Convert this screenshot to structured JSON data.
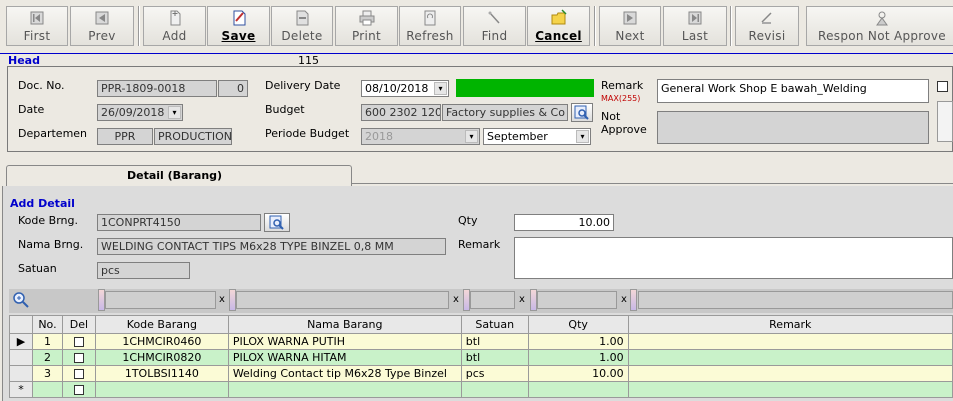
{
  "toolbar": {
    "buttons": [
      {
        "label": "First",
        "icon": "first-icon"
      },
      {
        "label": "Prev",
        "icon": "prev-icon"
      },
      {
        "label": "Add",
        "icon": "add-icon"
      },
      {
        "label": "Save",
        "icon": "save-icon"
      },
      {
        "label": "Delete",
        "icon": "delete-icon"
      },
      {
        "label": "Print",
        "icon": "print-icon"
      },
      {
        "label": "Refresh",
        "icon": "refresh-icon"
      },
      {
        "label": "Find",
        "icon": "find-icon"
      },
      {
        "label": "Cancel",
        "icon": "cancel-icon"
      },
      {
        "label": "Next",
        "icon": "next-icon"
      },
      {
        "label": "Last",
        "icon": "last-icon"
      },
      {
        "label": "Revisi",
        "icon": "revisi-icon"
      },
      {
        "label": "Respon Not Approve",
        "icon": "respon-icon"
      }
    ]
  },
  "head": {
    "title": "Head",
    "counter": "115",
    "doc_no_label": "Doc. No.",
    "doc_no": "PPR-1809-0018",
    "doc_rev": "0",
    "date_label": "Date",
    "date": "26/09/2018",
    "departemen_label": "Departemen",
    "dept_code": "PPR",
    "dept_name": "PRODUCTION",
    "delivery_label": "Delivery Date",
    "delivery_date": "08/10/2018",
    "budget_label": "Budget",
    "budget_code": "600 2302 120",
    "budget_name": "Factory supplies & Co",
    "periode_label": "Periode Budget",
    "periode_year": "2018",
    "periode_month": "September",
    "remark_label": "Remark",
    "remark_max": "MAX(255)",
    "remark": "General Work Shop E bawah_Welding",
    "not_approve_label": "Not\nApprove",
    "not_approve": "",
    "status_color": "#00b400"
  },
  "tab": {
    "label": "Detail (Barang)"
  },
  "detail": {
    "title": "Add Detail",
    "kode_label": "Kode Brng.",
    "kode": "1CONPRT4150",
    "nama_label": "Nama Brng.",
    "nama": "WELDING CONTACT TIPS M6x28 TYPE BINZEL 0,8 MM",
    "satuan_label": "Satuan",
    "satuan": "pcs",
    "qty_label": "Qty",
    "qty": "10.00",
    "remark_label": "Remark",
    "remark": ""
  },
  "grid": {
    "filter_x": "x",
    "columns": [
      "No.",
      "Del",
      "Kode Barang",
      "Nama Barang",
      "Satuan",
      "Qty",
      "Remark"
    ],
    "rows": [
      {
        "no": "1",
        "kode": "1CHMCIR0460",
        "nama": "PILOX WARNA PUTIH",
        "satuan": "btl",
        "qty": "1.00",
        "remark": ""
      },
      {
        "no": "2",
        "kode": "1CHMCIR0820",
        "nama": "PILOX WARNA HITAM",
        "satuan": "btl",
        "qty": "1.00",
        "remark": ""
      },
      {
        "no": "3",
        "kode": "1TOLBSI1140",
        "nama": "Welding Contact tip M6x28 Type Binzel",
        "satuan": "pcs",
        "qty": "10.00",
        "remark": ""
      }
    ],
    "new_row_marker": "*",
    "current_marker": "▶"
  }
}
